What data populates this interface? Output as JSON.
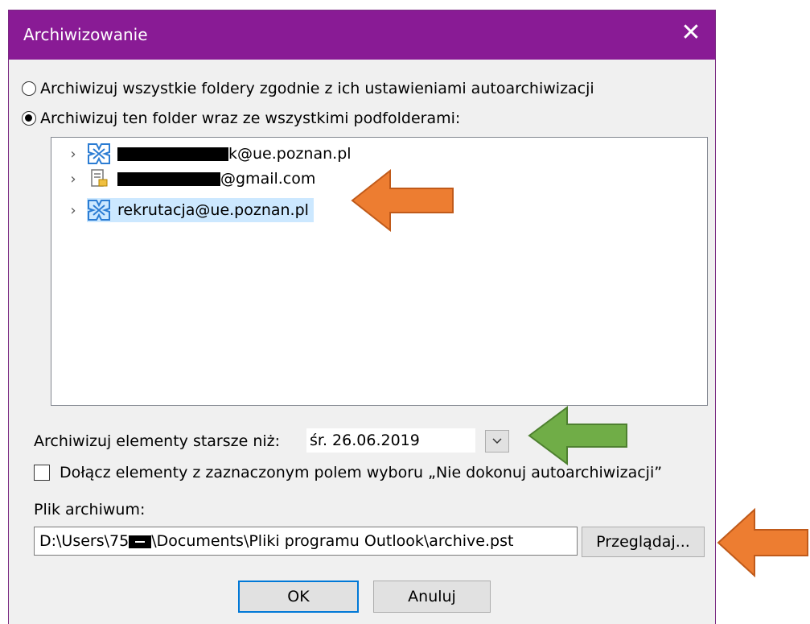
{
  "dialog": {
    "title": "Archiwizowanie",
    "close_symbol": "✕"
  },
  "options": {
    "archive_all_label": "Archiwizuj wszystkie foldery zgodnie z ich ustawieniami autoarchiwizacji",
    "archive_all_selected": false,
    "archive_folder_label": "Archiwizuj ten folder wraz ze wszystkimi podfolderami:",
    "archive_folder_selected": true
  },
  "folders": [
    {
      "suffix": "k@ue.poznan.pl",
      "icon": "exchange-mailbox-icon",
      "redacted": true
    },
    {
      "suffix": "@gmail.com",
      "icon": "pst-data-file-icon",
      "redacted": true
    },
    {
      "suffix": "rekrutacja@ue.poznan.pl",
      "icon": "exchange-mailbox-icon",
      "redacted": false,
      "selected": true
    }
  ],
  "older_than": {
    "label": "Archiwizuj elementy starsze niż:",
    "value": "śr. 26.06.2019"
  },
  "include_no_autoarchive": {
    "label": "Dołącz elementy z zaznaczonym polem wyboru „Nie dokonuj autoarchiwizacji”",
    "checked": false
  },
  "archive_file": {
    "label": "Plik archiwum:",
    "path_prefix": "D:\\Users\\75",
    "path_suffix": "\\Documents\\Pliki programu Outlook\\archive.pst",
    "browse_label": "Przeglądaj..."
  },
  "buttons": {
    "ok_label": "OK",
    "cancel_label": "Anuluj"
  },
  "colors": {
    "titlebar": "#891b95",
    "annotation_orange": "#ed7d31",
    "annotation_green": "#70ad47",
    "selection": "#cce8ff"
  }
}
